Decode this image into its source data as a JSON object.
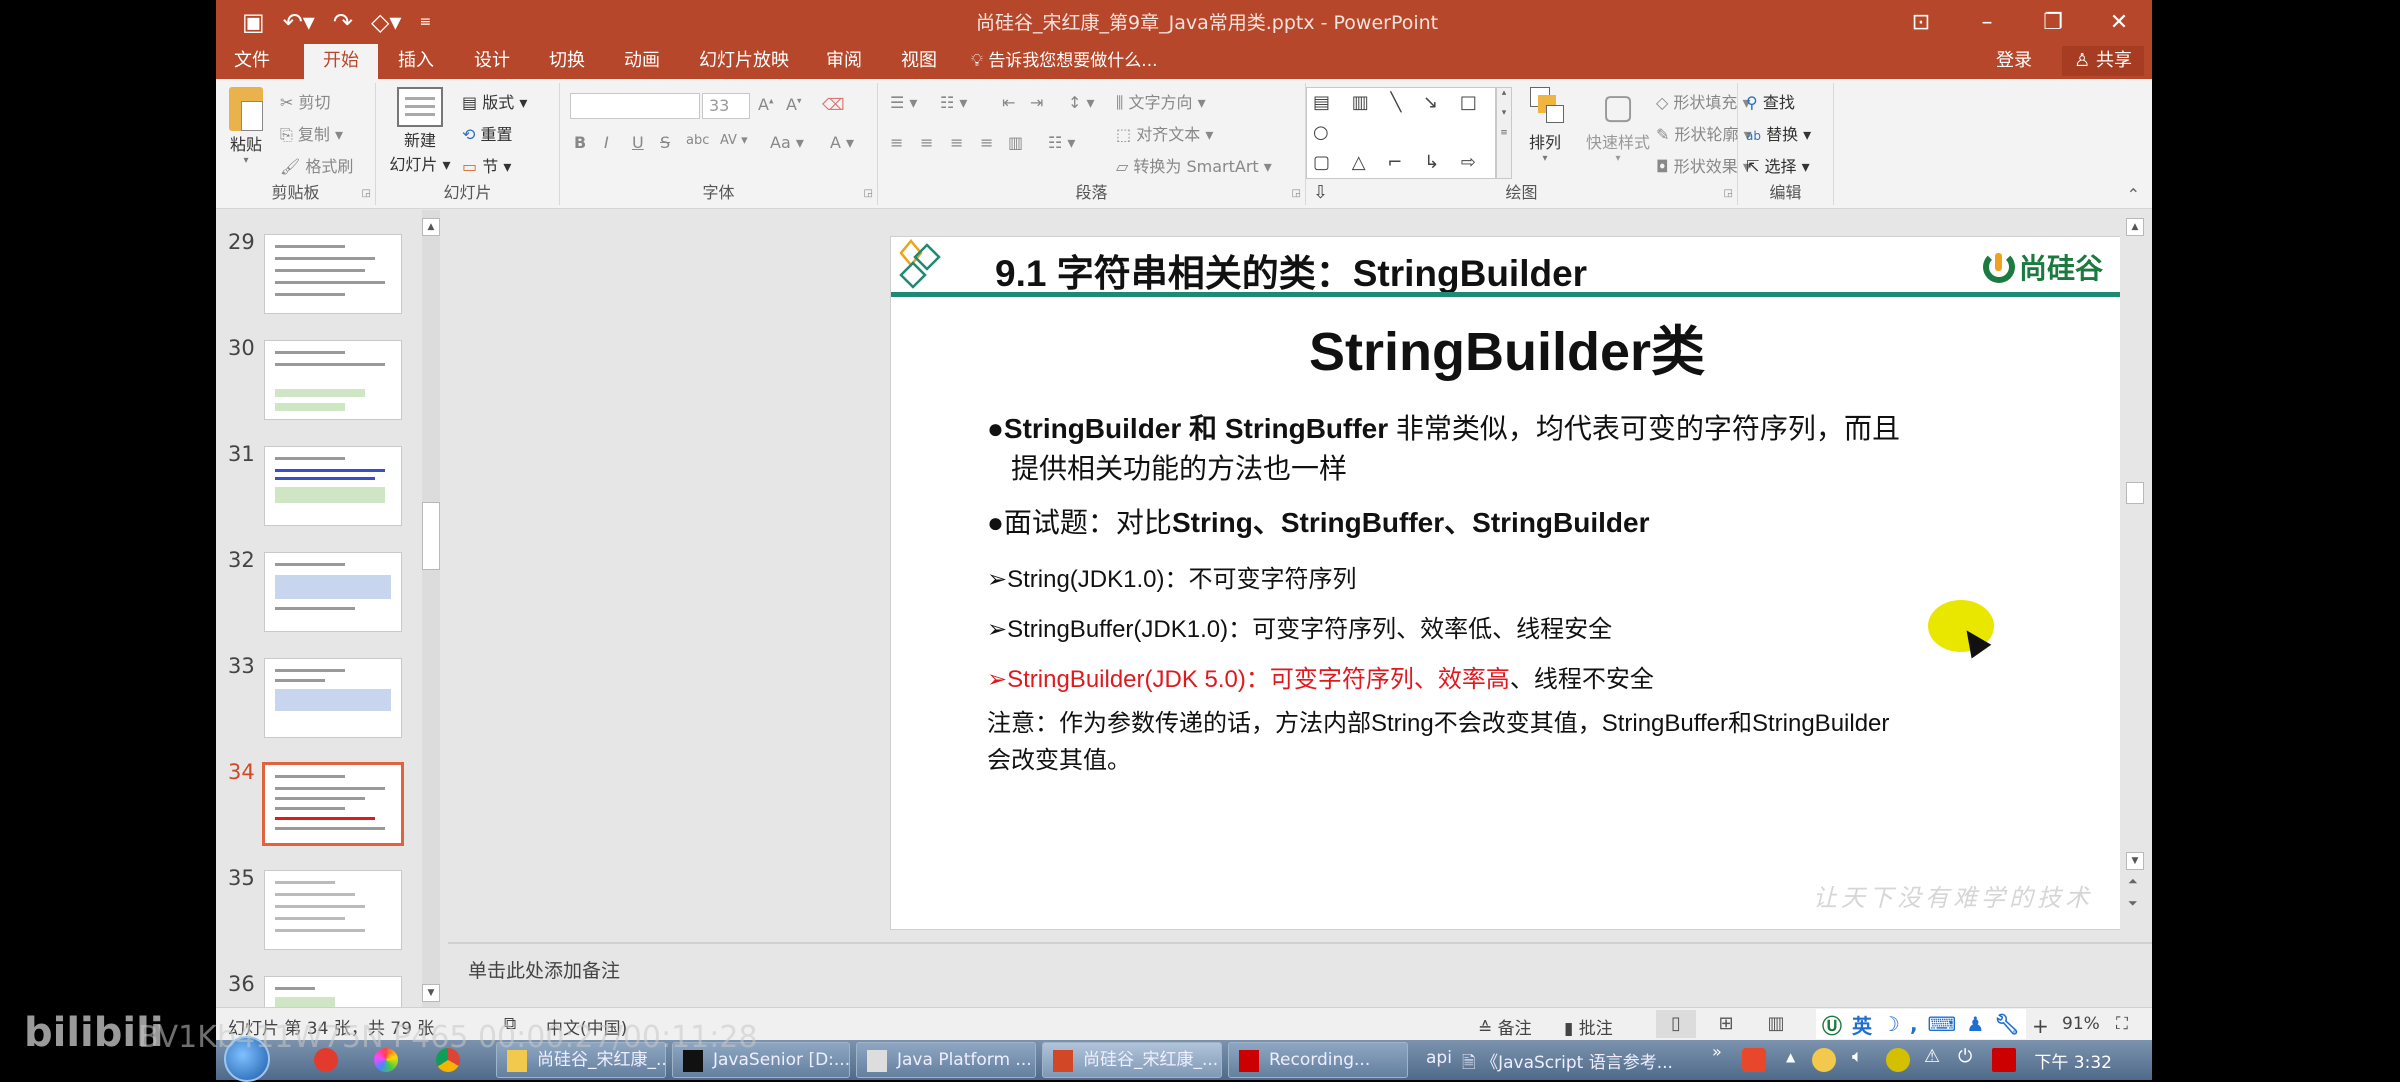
{
  "window": {
    "title": "尚硅谷_宋红康_第9章_Java常用类.pptx - PowerPoint",
    "controls": [
      "ribbon-display",
      "minimize",
      "restore",
      "close"
    ]
  },
  "quick_access": {
    "icons": [
      "save-icon",
      "undo-icon",
      "redo-icon",
      "start-from-beginning-icon",
      "customize-icon"
    ]
  },
  "ribbon_tabs": [
    {
      "label": "文件",
      "active": false
    },
    {
      "label": "开始",
      "active": true
    },
    {
      "label": "插入",
      "active": false
    },
    {
      "label": "设计",
      "active": false
    },
    {
      "label": "切换",
      "active": false
    },
    {
      "label": "动画",
      "active": false
    },
    {
      "label": "幻灯片放映",
      "active": false
    },
    {
      "label": "审阅",
      "active": false
    },
    {
      "label": "视图",
      "active": false
    }
  ],
  "tell_me": "告诉我您想要做什么...",
  "account": {
    "login": "登录",
    "share": "共享"
  },
  "ribbon": {
    "clipboard": {
      "label": "剪贴板",
      "paste": "粘贴",
      "cut": "剪切",
      "copy": "复制",
      "format_painter": "格式刷"
    },
    "slides": {
      "label": "幻灯片",
      "new_slide_1": "新建",
      "new_slide_2": "幻灯片",
      "layout": "版式",
      "reset": "重置",
      "section": "节"
    },
    "font": {
      "label": "字体",
      "font_name": "",
      "font_size": "33",
      "bold": "B",
      "italic": "I",
      "underline": "U",
      "strike": "S",
      "shadow": "abc",
      "spacing": "AV",
      "case": "Aa",
      "color": "A"
    },
    "paragraph": {
      "label": "段落",
      "text_direction": "文字方向",
      "align_text": "对齐文本",
      "smartart": "转换为 SmartArt"
    },
    "drawing": {
      "label": "绘图",
      "arrange": "排列",
      "quick_styles": "快速样式",
      "shape_fill": "形状填充",
      "shape_outline": "形状轮廓",
      "shape_effects": "形状效果",
      "shapes_row1": "▤ ▥ ╲ ↘ □ ○",
      "shapes_row2": "▢ △ ⌐ ↳ ⇨ ⇩",
      "shapes_row3": "◲ ∿ ╮ ∧ { }"
    },
    "editing": {
      "label": "编辑",
      "find": "查找",
      "replace": "替换",
      "select": "选择"
    }
  },
  "thumbnails": [
    {
      "number": "29",
      "active": false
    },
    {
      "number": "30",
      "active": false
    },
    {
      "number": "31",
      "active": false
    },
    {
      "number": "32",
      "active": false
    },
    {
      "number": "33",
      "active": false
    },
    {
      "number": "34",
      "active": true
    },
    {
      "number": "35",
      "active": false
    },
    {
      "number": "36",
      "active": false
    }
  ],
  "slide": {
    "header_title": "9.1 字符串相关的类：StringBuilder",
    "logo_text": "尚硅谷",
    "subtitle": "StringBuilder类",
    "bullet1_en": "StringBuilder 和 StringBuffer",
    "bullet1_cn": " 非常类似，均代表可变的字符序列，而且",
    "bullet1_line2": "提供相关功能的方法也一样",
    "bullet2_cn": "面试题：对比",
    "bullet2_en": "String、StringBuffer、StringBuilder",
    "sub1": "String(JDK1.0)：不可变字符序列",
    "sub2": "StringBuffer(JDK1.0)：可变字符序列、效率低、线程安全",
    "sub3_red": "StringBuilder(JDK 5.0)：可变字符序列、效率高",
    "sub3_black": "、线程不安全",
    "note_line1": "注意：作为参数传递的话，方法内部String不会改变其值，StringBuffer和StringBuilder",
    "note_line2": "会改变其值。",
    "watermark": "让天下没有难学的技术",
    "bullet_glyph": "●",
    "arrow_glyph": "➢"
  },
  "notes_placeholder": "单击此处添加备注",
  "status_bar": {
    "slide_count": "幻灯片 第 34 张，共 79 张",
    "language": "中文(中国)",
    "notes": "备注",
    "comments": "批注",
    "zoom": "91%",
    "ime_lang": "英"
  },
  "taskbar": {
    "items": [
      {
        "label": "尚硅谷_宋红康_...",
        "icon": "folder-icon"
      },
      {
        "label": "JavaSenior [D:...",
        "icon": "intellij-icon"
      },
      {
        "label": "Java Platform ...",
        "icon": "help-doc-icon"
      },
      {
        "label": "尚硅谷_宋红康_...",
        "icon": "powerpoint-icon"
      },
      {
        "label": "Recording...",
        "icon": "recording-icon"
      }
    ],
    "api_label": "api",
    "doc_item": "《JavaScript 语言参考...",
    "clock": "下午 3:32"
  },
  "overlay": {
    "bilibili": "bilibili",
    "video_id": "BV1Kb411W75N P465 00:00:27/00:11:28"
  },
  "colors": {
    "accent": "#b7472a",
    "slide_line": "#1f8a73",
    "red_text": "#e0191f",
    "active_thumb": "#e0633f"
  }
}
